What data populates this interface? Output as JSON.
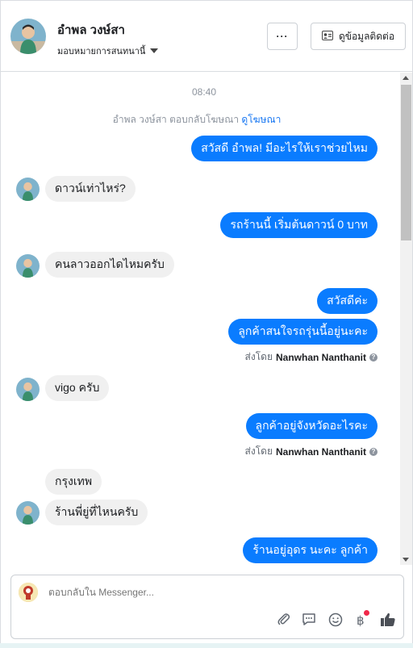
{
  "header": {
    "name": "อำพล วงษ์สา",
    "assign_label": "มอบหมายการสนทนานี้",
    "more_label": "···",
    "contact_label": "ดูข้อมูลติดต่อ"
  },
  "chat": {
    "time": "08:40",
    "system_text": "อำพล วงษ์สา ตอบกลับโฆษณา",
    "system_link": "ดูโฆษณา",
    "messages": [
      {
        "dir": "out",
        "text": "สวัสดี อำพล! มีอะไรให้เราช่วยไหม"
      },
      {
        "dir": "in",
        "text": "ดาวน์เท่าไหร่?"
      },
      {
        "dir": "out",
        "text": "รถร้านนี้ เริ่มต้นดาวน์ 0 บาท"
      },
      {
        "dir": "in",
        "text": "คนลาวออกไดไหมครับ"
      },
      {
        "dir": "out",
        "text": "สวัสดีค่ะ"
      },
      {
        "dir": "out",
        "text": "ลูกค้าสนใจรถรุ่นนี้อยู่นะคะ"
      },
      {
        "dir": "in",
        "text": "vigo ครับ"
      },
      {
        "dir": "out",
        "text": "ลูกค้าอยู่จังหวัดอะไรคะ"
      },
      {
        "dir": "in",
        "text": "กรุงเทพ"
      },
      {
        "dir": "in",
        "text": "ร้านพี่ยู่ที่ไหนครับ"
      },
      {
        "dir": "out",
        "text": "ร้านอยู่อุดร นะคะ ลูกค้า"
      }
    ],
    "sent_by_prefix": "ส่งโดย",
    "sent_by_name": "Nanwhan Nanthanit"
  },
  "composer": {
    "placeholder": "ตอบกลับใน Messenger...",
    "tools": [
      "paperclip-icon",
      "speech-bubble-icon",
      "smiley-icon",
      "baht-icon",
      "thumbs-up-icon"
    ]
  },
  "colors": {
    "outgoing_bubble": "#0a7cff",
    "incoming_bubble": "#f0f0f0",
    "link": "#1877f2"
  }
}
